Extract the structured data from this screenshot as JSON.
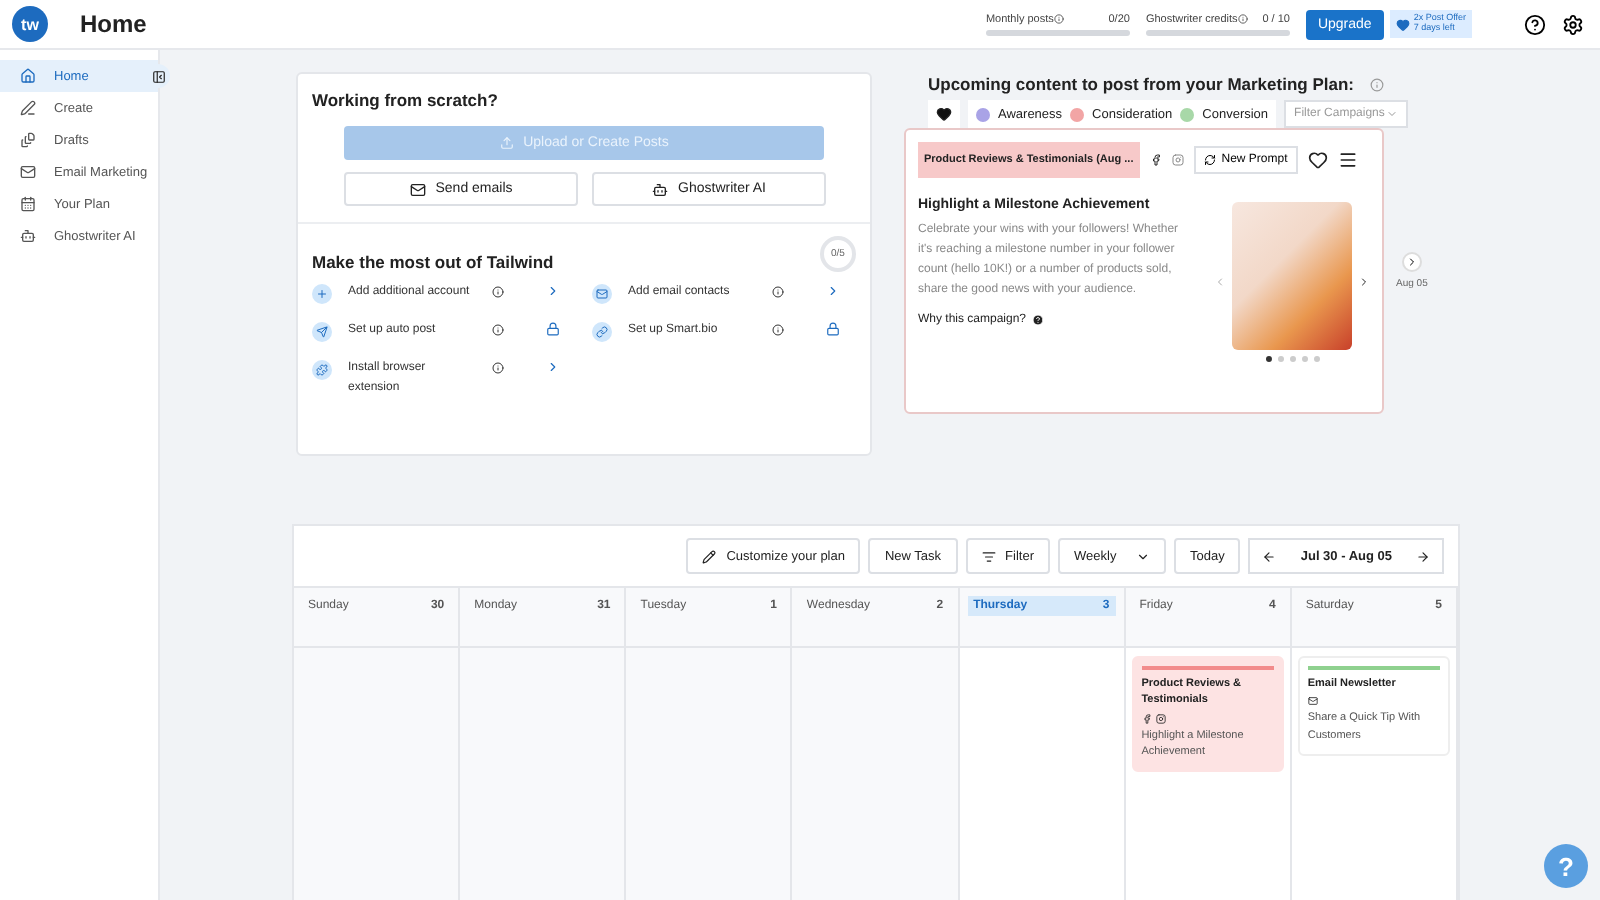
{
  "header": {
    "logo": "tw",
    "title": "Home",
    "meters": [
      {
        "label": "Monthly posts",
        "reading": "0/20",
        "level": 0
      },
      {
        "label": "Ghostwriter credits",
        "reading": "0 / 10",
        "level": 0
      }
    ],
    "upgrade": "Upgrade",
    "offer": [
      "2x Post Offer",
      "7 days left"
    ]
  },
  "sidebar": {
    "items": [
      {
        "label": "Home",
        "selected": true
      },
      {
        "label": "Create",
        "selected": false
      },
      {
        "label": "Drafts",
        "selected": false
      },
      {
        "label": "Email Marketing",
        "selected": false
      },
      {
        "label": "Your Plan",
        "selected": false
      },
      {
        "label": "Ghostwriter AI",
        "selected": false
      }
    ]
  },
  "scratch": {
    "title": "Working from scratch?",
    "primary": {
      "label": "Upload or Create Posts",
      "disabled": true
    },
    "buttons": [
      {
        "label": "Send emails"
      },
      {
        "label": "Ghostwriter AI"
      }
    ]
  },
  "tailwind": {
    "title": "Make the most out of Tailwind",
    "progress": "0/5",
    "tasks": [
      {
        "label": "Add additional account",
        "locked": false
      },
      {
        "label": "Add email contacts",
        "locked": false
      },
      {
        "label": "Set up auto post",
        "locked": true
      },
      {
        "label": "Set up Smart.bio",
        "locked": true
      },
      {
        "label": "Install browser extension",
        "locked": false
      }
    ]
  },
  "plan": {
    "title": "Upcoming content to post from your Marketing Plan:",
    "legend": [
      {
        "label": "Awareness",
        "color": "#a9a3e6"
      },
      {
        "label": "Consideration",
        "color": "#f2a5a5"
      },
      {
        "label": "Conversion",
        "color": "#a8d8a8"
      }
    ],
    "filter_placeholder": "Filter Campaigns",
    "card": {
      "campaign": "Product Reviews & Testimonials (Aug ...",
      "new_prompt": "New Prompt",
      "headline": "Highlight a Milestone Achievement",
      "body": "Celebrate your wins with your followers! Whether it's reaching a milestone number in your follower count (hello 10K!) or a number of products sold, share the good news with your audience.",
      "why": "Why this campaign?",
      "slides": [
        {
          "selected": true
        },
        {
          "selected": false
        },
        {
          "selected": false
        },
        {
          "selected": false
        },
        {
          "selected": false
        }
      ]
    },
    "next_date": "Aug 05"
  },
  "calendar": {
    "toolbar": {
      "customize": "Customize your plan",
      "new_task": "New Task",
      "filter": "Filter",
      "view": "Weekly",
      "today": "Today",
      "range": "Jul 30 - Aug 05"
    },
    "days": [
      {
        "name": "Sunday",
        "date": "30",
        "selected": false
      },
      {
        "name": "Monday",
        "date": "31",
        "selected": false
      },
      {
        "name": "Tuesday",
        "date": "1",
        "selected": false
      },
      {
        "name": "Wednesday",
        "date": "2",
        "selected": false
      },
      {
        "name": "Thursday",
        "date": "3",
        "selected": true
      },
      {
        "name": "Friday",
        "date": "4",
        "selected": false,
        "event": {
          "title": "Product Reviews & Testimonials",
          "kind": "social",
          "text": "Highlight a Milestone Achievement",
          "color": "#f28b8b"
        }
      },
      {
        "name": "Saturday",
        "date": "5",
        "selected": false,
        "event": {
          "title": "Email Newsletter",
          "kind": "email",
          "text": "Share a Quick Tip With Customers",
          "color": "#8fd18f"
        }
      }
    ]
  },
  "help": "?"
}
